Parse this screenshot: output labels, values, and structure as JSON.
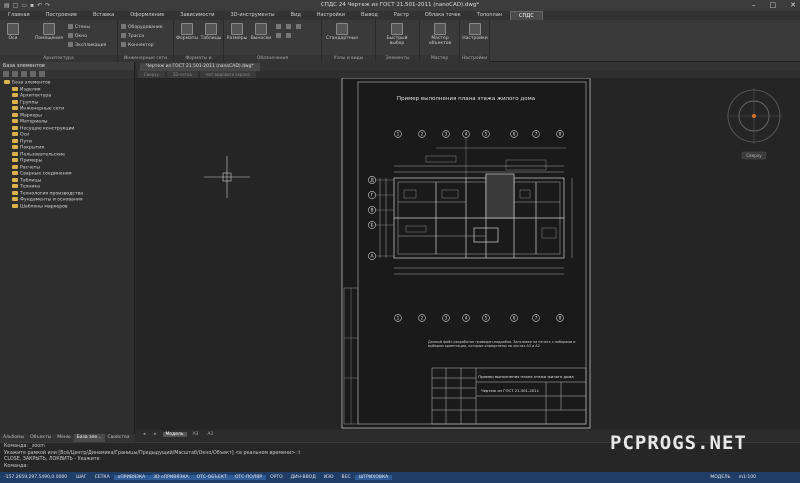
{
  "app": {
    "title": "СПДС 24 Чертеж из ГОСТ 21.501-2011 (nanoCAD).dwg*"
  },
  "menu": {
    "tabs": [
      "Главная",
      "Построение",
      "Вставка",
      "Оформление",
      "Зависимости",
      "3D-инструменты",
      "Вид",
      "Настройки",
      "Вывод",
      "Растр",
      "Облака точек",
      "Топоплан",
      "СПДС"
    ],
    "active": "СПДС"
  },
  "ribbon": {
    "groups": [
      {
        "title": "Архитектура",
        "buttons": [
          "Оси",
          "Помещения"
        ],
        "small": [
          "Стены",
          "Окно",
          "Экспликация"
        ]
      },
      {
        "title": "Инженерные сети",
        "buttons": [],
        "small": [
          "Оборудование",
          "Трасса",
          "Коннектор"
        ]
      },
      {
        "title": "Форматы и основные",
        "buttons": [
          "Форматы",
          "Таблицы"
        ],
        "small": []
      },
      {
        "title": "Обозначения",
        "buttons": [
          "Размеры",
          "Выноски"
        ],
        "small": []
      },
      {
        "title": "Узлы и виды",
        "buttons": [
          "Стандартные"
        ],
        "small": []
      },
      {
        "title": "Элементы",
        "buttons": [
          "Быстрый выбор"
        ],
        "small": []
      },
      {
        "title": "Мастер объектов",
        "buttons": [
          "Мастер объектов"
        ],
        "small": []
      },
      {
        "title": "Настройки",
        "buttons": [
          "Настройки"
        ],
        "small": []
      }
    ]
  },
  "left_panel": {
    "title": "База элементов",
    "tree": [
      "База элементов",
      "Изделия",
      "Архитектура",
      "Группы",
      "Инженерные сети",
      "Маркеры",
      "Материалы",
      "Несущие конструкции",
      "Оси",
      "Пути",
      "Покрытия",
      "Пользовательские",
      "Примеры",
      "Расчеты",
      "Сварные соединения",
      "Таблицы",
      "Техника",
      "Технология производства",
      "Фундаменты и основания",
      "Шаблоны маркеров"
    ],
    "tabs": [
      "Альбомы",
      "Объекты",
      "Меню",
      "База эле...",
      "Свойства"
    ],
    "active_tab": "База эле..."
  },
  "document": {
    "tab": "Чертеж из ГОСТ 21.501-2011 (nanoCAD).dwg*",
    "subtabs": [
      "Сверху",
      "2D-сетка",
      "нет видового экрана"
    ],
    "model_tabs": [
      "Модель",
      "A3",
      "A1"
    ],
    "active_model_tab": "Модель"
  },
  "drawing": {
    "title": "Пример выполнения плана этажа жилого дома",
    "stamp_title": "Пример выполнения плана этажа жилого дома",
    "stamp_code": "Чертеж из ГОСТ 21.501-2011",
    "note": "Данный файл разработан приведен-подробно. Заголовки на печать с наборами и выбором ориентации, которые определены на листах А3 и А2",
    "axes_letters": [
      "Д",
      "Г",
      "В",
      "Б",
      "А"
    ],
    "axes_numbers": [
      "1",
      "2",
      "3",
      "4",
      "5",
      "6",
      "7",
      "8"
    ]
  },
  "viewcube": {
    "label": "Сверху"
  },
  "cmdline": {
    "lines": [
      "Команда: _zoom",
      "Укажите рамкой или [Всё/Центр/Динамика/Границы/Предыдущий/Масштаб/Окно/Объект] <в реальном времени>: t",
      "CLOSE, ЗАКРЫТЬ, ЛОКВИТЬ - Укажите",
      "Команда:"
    ]
  },
  "status": {
    "coords": "-157.2659,297.5490,0.0000",
    "items": [
      "ШАГ",
      "СЕТКА",
      "оПРИВЯЗКА",
      "3D оПРИВЯЗКА",
      "ОТС-ОБЪЕКТ",
      "ОТС-ПОЛЯР",
      "ОРТО",
      "ДИН-ВВОД",
      "ИЗО",
      "ВЕС",
      "ШТРИХОВКА"
    ],
    "on": [
      "оПРИВЯЗКА",
      "3D оПРИВЯЗКА",
      "ОТС-ОБЪЕКТ",
      "ОТС-ПОЛЯР",
      "ШТРИХОВКА"
    ],
    "model": "МОДЕЛЬ",
    "scale": "m1:100"
  },
  "watermark": "PCPROGS.NET"
}
